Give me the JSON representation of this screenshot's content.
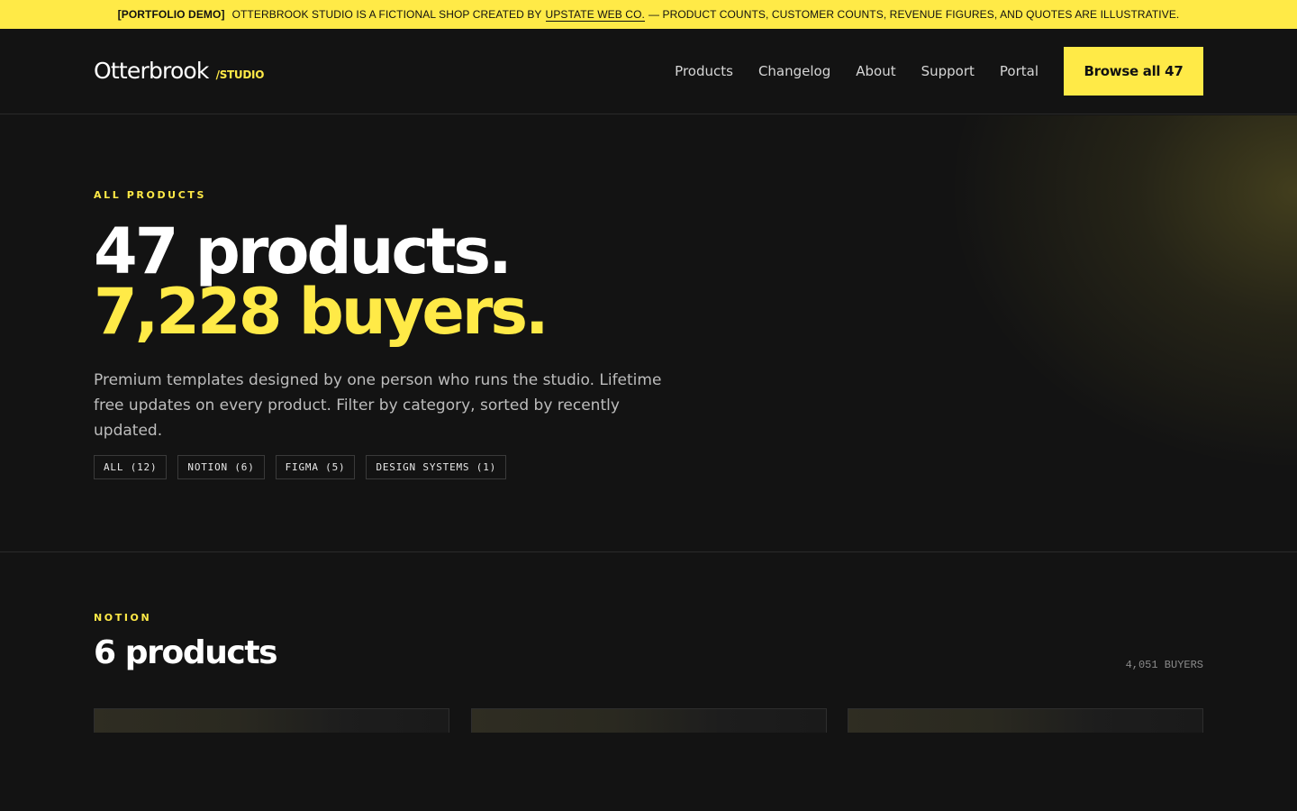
{
  "banner": {
    "prefix": "[PORTFOLIO DEMO]",
    "text_before": "OTTERBROOK STUDIO IS A FICTIONAL SHOP CREATED BY",
    "link": "UPSTATE WEB CO.",
    "text_after": "— PRODUCT COUNTS, CUSTOMER COUNTS, REVENUE FIGURES, AND QUOTES ARE ILLUSTRATIVE."
  },
  "brand": {
    "name": "Otterbrook",
    "tag": "/STUDIO",
    "accent": "#ffea47"
  },
  "nav": {
    "items": [
      "Products",
      "Changelog",
      "About",
      "Support",
      "Portal"
    ],
    "cta": "Browse all 47"
  },
  "hero": {
    "eyebrow": "ALL PRODUCTS",
    "line1": "47 products.",
    "line2": "7,228 buyers.",
    "lead": "Premium templates designed by one person who runs the studio. Lifetime free updates on every product. Filter by category, sorted by recently updated.",
    "filters": [
      "ALL (12)",
      "NOTION (6)",
      "FIGMA (5)",
      "DESIGN SYSTEMS (1)"
    ]
  },
  "section": {
    "eyebrow": "NOTION",
    "title": "6 products",
    "count": "4,051 BUYERS"
  }
}
